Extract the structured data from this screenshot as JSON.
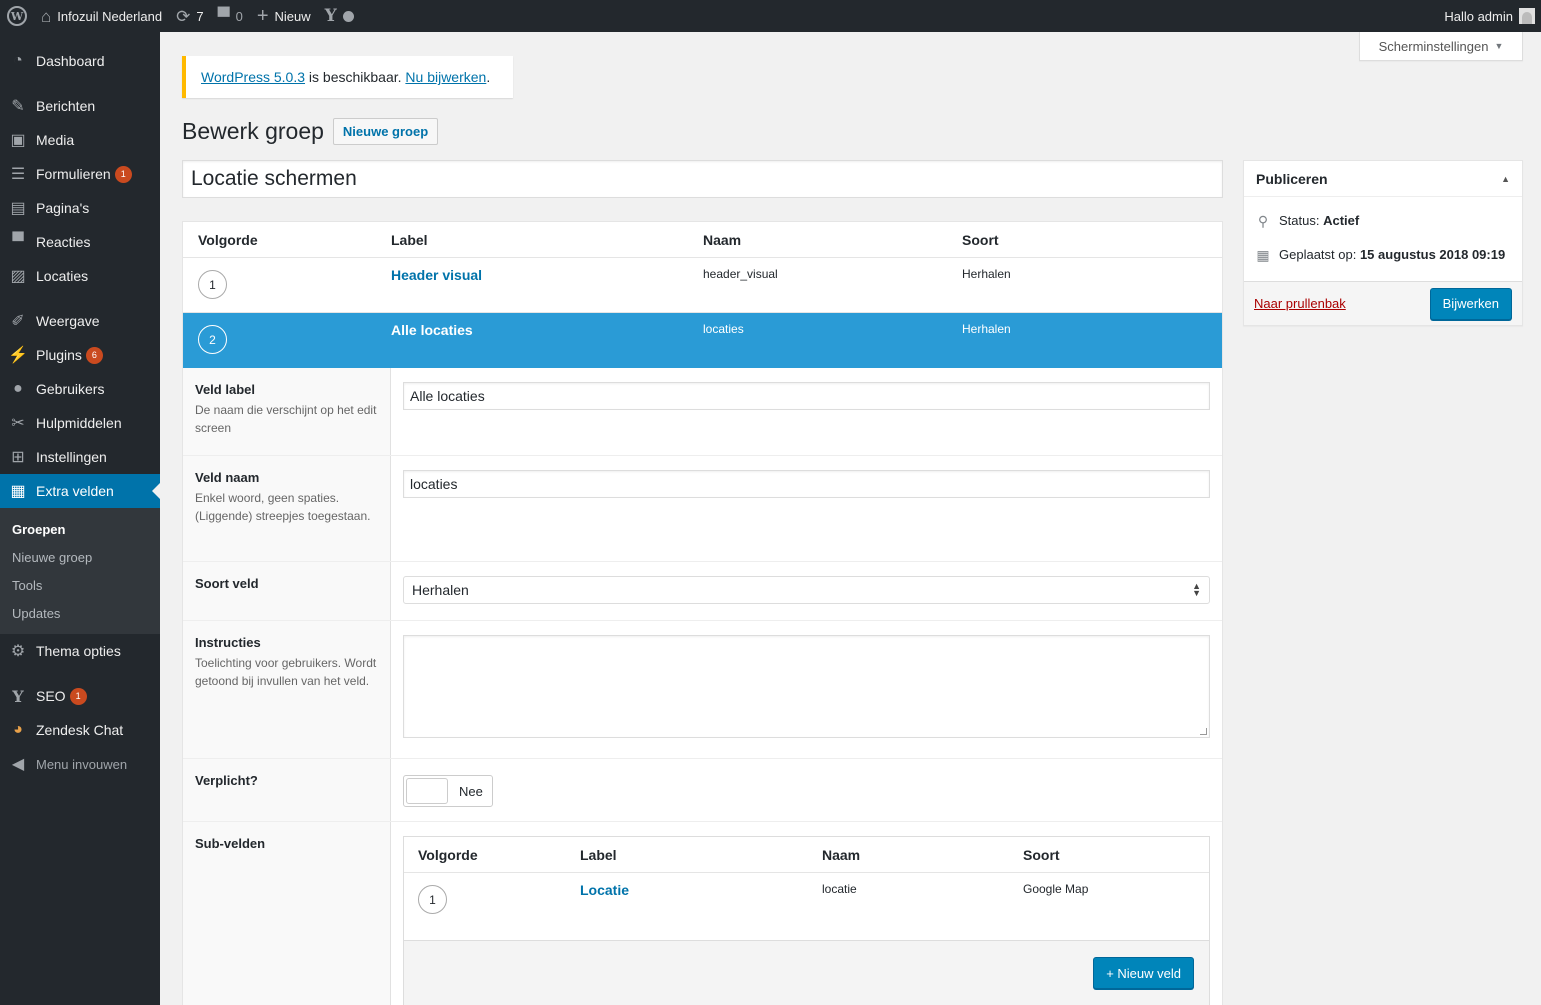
{
  "adminbar": {
    "site_name": "Infozuil Nederland",
    "updates_count": "7",
    "comments_count": "0",
    "new_label": "Nieuw",
    "greeting": "Hallo admin"
  },
  "sidebar": {
    "items": [
      {
        "label": "Dashboard"
      },
      {
        "label": "Berichten"
      },
      {
        "label": "Media"
      },
      {
        "label": "Formulieren",
        "badge": "1"
      },
      {
        "label": "Pagina's"
      },
      {
        "label": "Reacties"
      },
      {
        "label": "Locaties"
      },
      {
        "label": "Weergave"
      },
      {
        "label": "Plugins",
        "badge": "6"
      },
      {
        "label": "Gebruikers"
      },
      {
        "label": "Hulpmiddelen"
      },
      {
        "label": "Instellingen"
      },
      {
        "label": "Extra velden"
      },
      {
        "label": "Thema opties"
      },
      {
        "label": "SEO",
        "badge": "1"
      },
      {
        "label": "Zendesk Chat"
      },
      {
        "label": "Menu invouwen"
      }
    ],
    "submenu": [
      "Groepen",
      "Nieuwe groep",
      "Tools",
      "Updates"
    ]
  },
  "screen_options": "Scherminstellingen",
  "notice": {
    "link1": "WordPress 5.0.3",
    "text": " is beschikbaar. ",
    "link2": "Nu bijwerken",
    "end": "."
  },
  "page": {
    "title": "Bewerk groep",
    "new_button": "Nieuwe groep",
    "group_title": "Locatie schermen"
  },
  "fields_table": {
    "headers": [
      "Volgorde",
      "Label",
      "Naam",
      "Soort"
    ],
    "rows": [
      {
        "order": "1",
        "label": "Header visual",
        "name": "header_visual",
        "type": "Herhalen"
      },
      {
        "order": "2",
        "label": "Alle locaties",
        "name": "locaties",
        "type": "Herhalen"
      }
    ]
  },
  "field_settings": {
    "label_title": "Veld label",
    "label_desc": "De naam die verschijnt op het edit screen",
    "label_value": "Alle locaties",
    "name_title": "Veld naam",
    "name_desc": "Enkel woord, geen spaties. (Liggende) streepjes toegestaan.",
    "name_value": "locaties",
    "type_title": "Soort veld",
    "type_value": "Herhalen",
    "instr_title": "Instructies",
    "instr_desc": "Toelichting voor gebruikers. Wordt getoond bij invullen van het veld.",
    "instr_value": "",
    "required_title": "Verplicht?",
    "required_value": "Nee",
    "subfields_title": "Sub-velden"
  },
  "subfields": {
    "headers": [
      "Volgorde",
      "Label",
      "Naam",
      "Soort"
    ],
    "rows": [
      {
        "order": "1",
        "label": "Locatie",
        "name": "locatie",
        "type": "Google Map"
      }
    ],
    "add_button": "+ Nieuw veld"
  },
  "publish": {
    "title": "Publiceren",
    "status_label": "Status: ",
    "status_value": "Actief",
    "date_label": "Geplaatst op: ",
    "date_value": "15 augustus 2018 09:19",
    "trash": "Naar prullenbak",
    "update": "Bijwerken"
  },
  "colors": {
    "accent": "#0073aa",
    "selected_row": "#2a9bd6",
    "sidebar_bg": "#23282d",
    "badge": "#ca4a1f",
    "notice_warning": "#ffb900"
  }
}
